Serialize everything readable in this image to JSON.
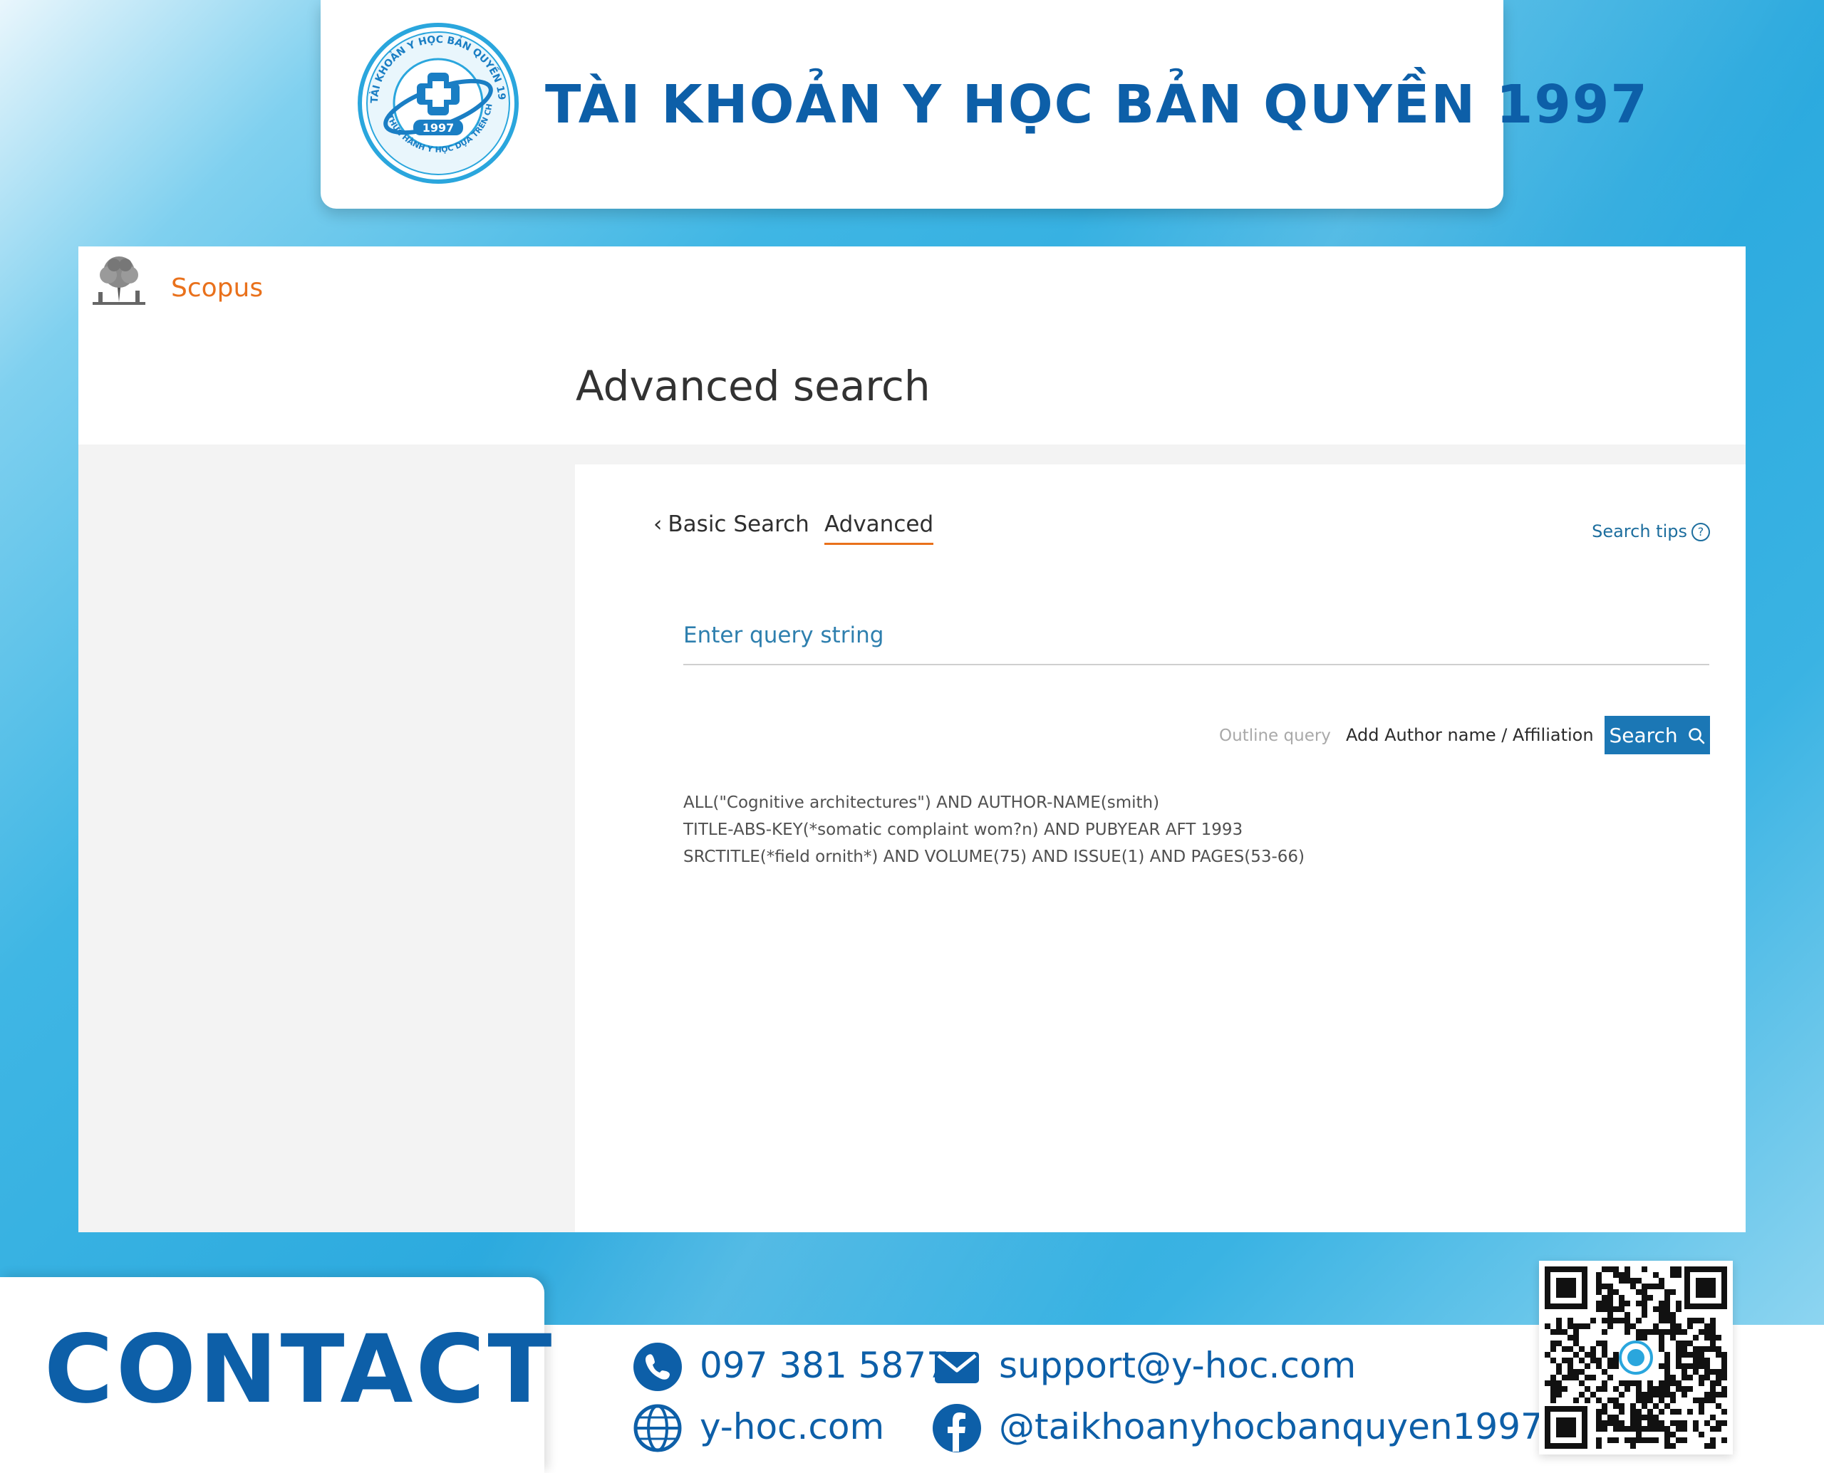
{
  "banner": {
    "title": "TÀI KHOẢN Y HỌC BẢN QUYỀN 1997",
    "logo": {
      "ring_text_top": "TÀI KHOẢN Y HỌC BẢN QUYỀN 1997",
      "ring_text_bottom": "THỰC HÀNH Y HỌC DỰA TRÊN CHỨNG CỨ",
      "center_text": "1997"
    }
  },
  "app": {
    "brand": "Scopus",
    "page_title": "Advanced search"
  },
  "tabs": {
    "basic_label": "Basic Search",
    "advanced_label": "Advanced"
  },
  "search_tips": {
    "label": "Search tips"
  },
  "query": {
    "placeholder": "Enter query string",
    "value": ""
  },
  "actions": {
    "outline_query": "Outline query",
    "add_author": "Add Author name / Affiliation",
    "search_button": "Search"
  },
  "examples": [
    "ALL(\"Cognitive architectures\") AND AUTHOR-NAME(smith)",
    "TITLE-ABS-KEY(*somatic complaint wom?n) AND PUBYEAR AFT 1993",
    "SRCTITLE(*field ornith*) AND VOLUME(75) AND ISSUE(1) AND PAGES(53-66)"
  ],
  "contact": {
    "title": "CONTACT",
    "phone": "097 381 5877",
    "email": "support@y-hoc.com",
    "website": "y-hoc.com",
    "facebook": "@taikhoanyhocbanquyen1997"
  },
  "colors": {
    "brand_blue": "#0d5fa8",
    "scopus_orange": "#e9711c",
    "link_blue": "#1d6e9e",
    "button_blue": "#1b77b5"
  },
  "icons": [
    "logo-seal",
    "elsevier-tree-icon",
    "chevron-left-icon",
    "question-circle-icon",
    "search-icon",
    "phone-icon",
    "email-icon",
    "globe-icon",
    "facebook-icon",
    "qr-code"
  ]
}
